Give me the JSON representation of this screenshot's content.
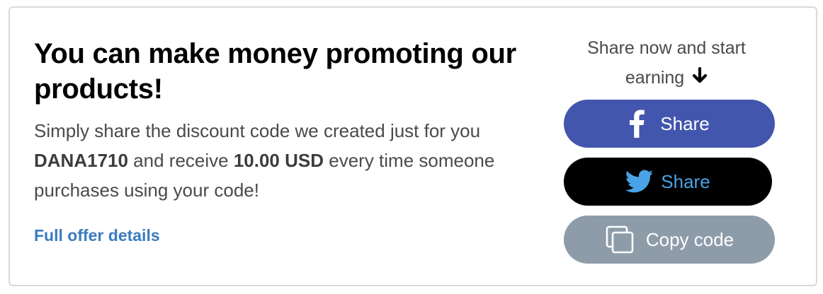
{
  "promo": {
    "headline": "You can make money promoting our products!",
    "description_before_code": "Simply share the discount code we created just for you ",
    "discount_code": "DANA1710",
    "description_middle": " and receive ",
    "reward_amount": "10.00 USD",
    "description_after": " every time someone purchases using your code!",
    "details_link": "Full offer details"
  },
  "share": {
    "cta_text": "Share now and start earning",
    "cta_icon": "arrow-down-icon",
    "facebook": {
      "label": "Share",
      "icon": "facebook-icon",
      "color": "#4356ad"
    },
    "twitter": {
      "label": "Share",
      "icon": "twitter-icon",
      "color": "#000000",
      "text_color": "#4aa3e6"
    },
    "copy": {
      "label": "Copy code",
      "icon": "copy-icon",
      "color": "#8e9caa"
    }
  }
}
